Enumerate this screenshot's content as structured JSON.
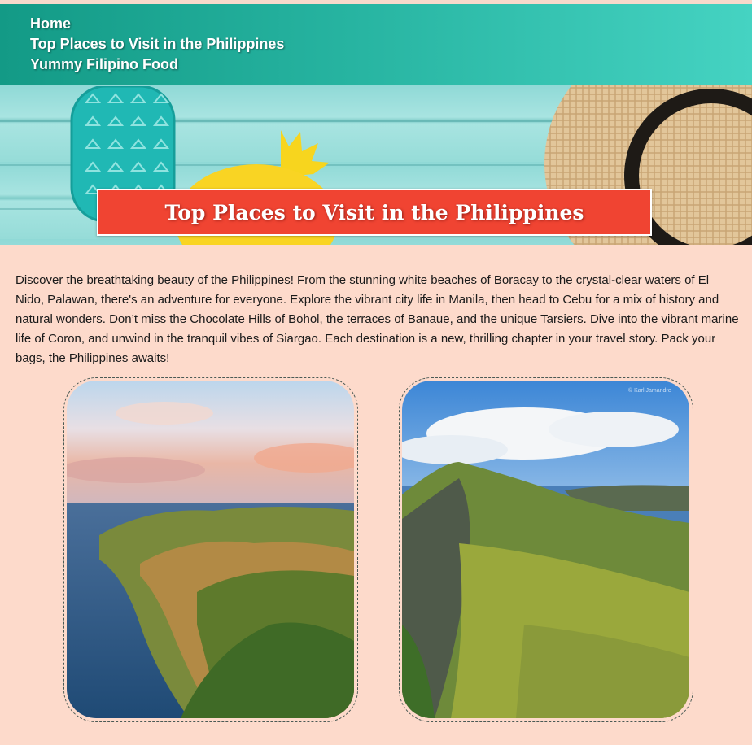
{
  "nav": {
    "items": [
      {
        "label": "Home"
      },
      {
        "label": "Top Places to Visit in the Philippines"
      },
      {
        "label": "Yummy Filipino Food"
      }
    ]
  },
  "hero": {
    "title": "Top Places to Visit in the Philippines"
  },
  "intro": {
    "text": "Discover the breathtaking beauty of the Philippines! From the stunning white beaches of Boracay to the crystal-clear waters of El Nido, Palawan, there's an adventure for everyone. Explore the vibrant city life in Manila, then head to Cebu for a mix of history and natural wonders. Don’t miss the Chocolate Hills of Bohol, the terraces of Banaue, and the unique Tarsiers. Dive into the vibrant marine life of Coron, and unwind in the tranquil vibes of Siargao. Each destination is a new, thrilling chapter in your travel story. Pack your bags, the Philippines awaits!"
  },
  "gallery": {
    "photo_2_watermark": "© Karl Jamandre"
  },
  "colors": {
    "nav_start": "#139a86",
    "nav_end": "#45d3c2",
    "title_red": "#f04432",
    "page_bg": "#fddacb"
  }
}
